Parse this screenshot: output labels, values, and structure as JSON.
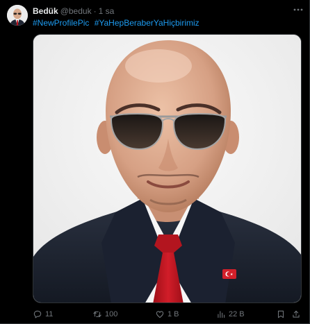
{
  "tweet": {
    "author_name": "Bedük",
    "handle": "@beduk",
    "separator": "·",
    "time": "1 sa",
    "more_icon": "more-dots-icon",
    "hashtags": [
      "#NewProfilePic",
      "#YaHepBeraberYaHiçbirimiz"
    ]
  },
  "actions": {
    "replies": "11",
    "reposts": "100",
    "likes": "1 B",
    "views": "22 B",
    "icons": [
      "reply-icon",
      "repost-icon",
      "like-icon",
      "views-icon",
      "bookmark-icon",
      "share-icon"
    ]
  },
  "colors": {
    "background": "#000000",
    "text": "#e7e9ea",
    "muted": "#71767b",
    "link": "#1d9bf0",
    "border": "#2f3336"
  }
}
